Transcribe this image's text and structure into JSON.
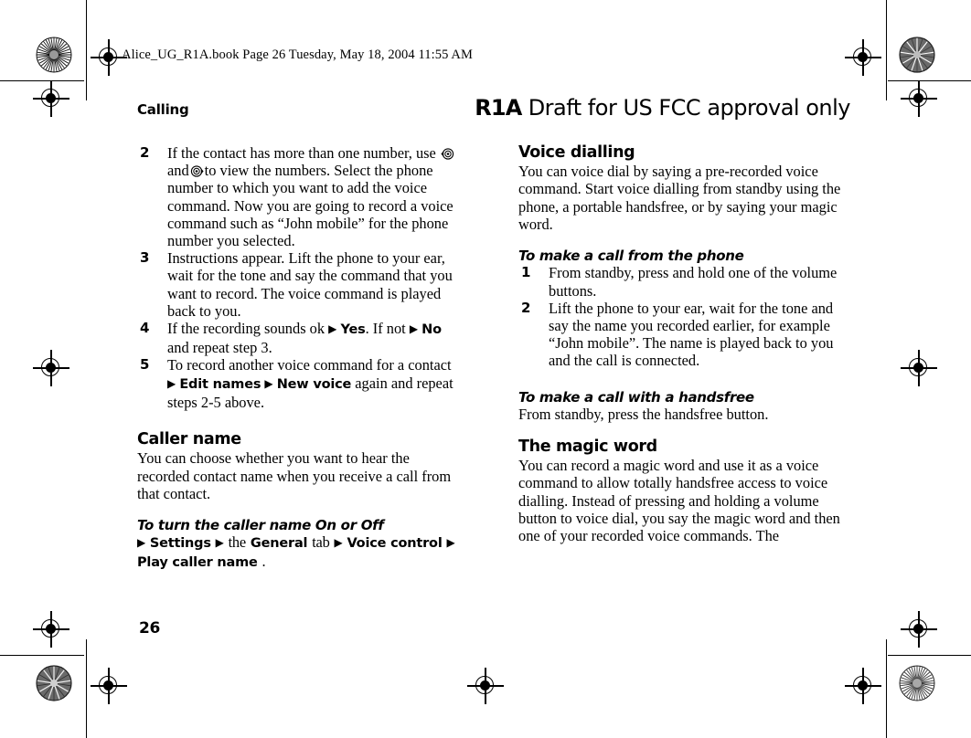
{
  "filestamp": "Alice_UG_R1A.book  Page 26  Tuesday, May 18, 2004  11:55 AM",
  "running_head": {
    "chapter": "Calling",
    "revision": "R1A",
    "notice": "Draft for US FCC approval only"
  },
  "folio": "26",
  "left_column": {
    "steps": [
      {
        "number": "2",
        "text_before_keys": "If the contact has more than one number, use",
        "key_left": "nav-key-left",
        "conjunction": "and",
        "key_right": "nav-key-right",
        "text_after_keys": "to view the numbers. Select the phone number to which you want to add the voice command. Now you are going to record a voice command such as “John mobile” for the phone number you selected."
      },
      {
        "number": "3",
        "text": "Instructions appear. Lift the phone to your ear, wait for the tone and say the command that you want to record. The voice command is played back to you."
      },
      {
        "number": "4",
        "segments": [
          {
            "type": "text",
            "value": "If the recording sounds ok "
          },
          {
            "type": "arrow",
            "value": "▶"
          },
          {
            "type": "ui",
            "value": "Yes"
          },
          {
            "type": "text",
            "value": ". If not "
          },
          {
            "type": "arrow",
            "value": "▶"
          },
          {
            "type": "ui",
            "value": "No"
          },
          {
            "type": "text",
            "value": " and repeat step 3."
          }
        ]
      },
      {
        "number": "5",
        "segments": [
          {
            "type": "text",
            "value": "To record another voice command for a contact "
          },
          {
            "type": "arrow",
            "value": "▶"
          },
          {
            "type": "ui",
            "value": "Edit names"
          },
          {
            "type": "arrow",
            "value": "▶"
          },
          {
            "type": "ui",
            "value": "New voice"
          },
          {
            "type": "text",
            "value": " again and repeat steps 2-5 above."
          }
        ]
      }
    ],
    "caller_name": {
      "heading": "Caller name",
      "body": "You can choose whether you want to hear the recorded contact name when you receive a call from that contact.",
      "procedure_heading": "To turn the caller name On or Off",
      "menu_path": [
        {
          "type": "arrow",
          "value": "▶"
        },
        {
          "type": "ui",
          "value": "Settings"
        },
        {
          "type": "arrow",
          "value": "▶"
        },
        {
          "type": "serif",
          "value": "the"
        },
        {
          "type": "ui",
          "value": "General"
        },
        {
          "type": "serif",
          "value": "tab"
        },
        {
          "type": "arrow",
          "value": "▶"
        },
        {
          "type": "ui",
          "value": "Voice control"
        },
        {
          "type": "arrow",
          "value": "▶"
        },
        {
          "type": "ui",
          "value": "Play caller name"
        },
        {
          "type": "serif",
          "value": "."
        }
      ]
    }
  },
  "right_column": {
    "voice_dialling": {
      "heading": "Voice dialling",
      "body": "You can voice dial by saying a pre-recorded voice command. Start voice dialling from standby using the phone, a portable handsfree, or by saying your magic word."
    },
    "call_from_phone": {
      "heading": "To make a call from the phone",
      "steps": [
        {
          "number": "1",
          "text": "From standby, press and hold one of the volume buttons."
        },
        {
          "number": "2",
          "text": "Lift the phone to your ear, wait for the tone and say the name you recorded earlier, for example “John mobile”. The name is played back to you and the call is connected."
        }
      ]
    },
    "call_with_handsfree": {
      "heading": "To make a call with a handsfree",
      "body": "From standby, press the handsfree button."
    },
    "magic_word": {
      "heading": "The magic word",
      "body": "You can record a magic word and use it as a voice command to allow totally handsfree access to voice dialling. Instead of pressing and holding a volume button to voice dial, you say the magic word and then one of your recorded voice commands. The"
    }
  },
  "colors": {
    "ink": "#000000",
    "paper": "#ffffff",
    "halftone": "#808080"
  }
}
